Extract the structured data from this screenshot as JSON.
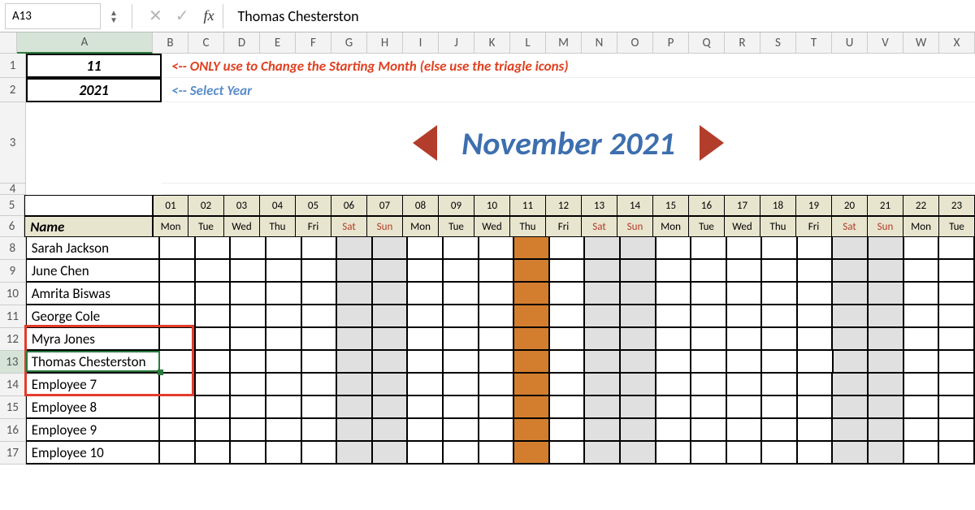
{
  "formula_bar": {
    "name_box": "A13",
    "fx_label": "fx",
    "formula_value": "Thomas Chesterston"
  },
  "columns": [
    "A",
    "B",
    "C",
    "D",
    "E",
    "F",
    "G",
    "H",
    "I",
    "J",
    "K",
    "L",
    "M",
    "N",
    "O",
    "P",
    "Q",
    "R",
    "S",
    "T",
    "U",
    "V",
    "W",
    "X"
  ],
  "row_labels": {
    "r1": "1",
    "r2": "2",
    "r3": "3",
    "r4": "4",
    "r5": "5",
    "r6": "6"
  },
  "cellA": {
    "r1": "11",
    "r2": "2021"
  },
  "hints": {
    "r1": "<-- ONLY use to Change the Starting Month (else use the triagle icons)",
    "r2": "<-- Select Year"
  },
  "month_title": "November 2021",
  "day_nums": [
    "01",
    "02",
    "03",
    "04",
    "05",
    "06",
    "07",
    "08",
    "09",
    "10",
    "11",
    "12",
    "13",
    "14",
    "15",
    "16",
    "17",
    "18",
    "19",
    "20",
    "21",
    "22",
    "23"
  ],
  "day_dows": [
    "Mon",
    "Tue",
    "Wed",
    "Thu",
    "Fri",
    "Sat",
    "Sun",
    "Mon",
    "Tue",
    "Wed",
    "Thu",
    "Fri",
    "Sat",
    "Sun",
    "Mon",
    "Tue",
    "Wed",
    "Thu",
    "Fri",
    "Sat",
    "Sun",
    "Mon",
    "Tue"
  ],
  "weekend_idx": [
    5,
    6,
    12,
    13,
    19,
    20
  ],
  "holiday_idx": [
    10
  ],
  "name_header": "Name",
  "employees": [
    {
      "row": "8",
      "name": "Sarah Jackson"
    },
    {
      "row": "9",
      "name": "June Chen"
    },
    {
      "row": "10",
      "name": "Amrita Biswas"
    },
    {
      "row": "11",
      "name": "George Cole"
    },
    {
      "row": "12",
      "name": "Myra Jones"
    },
    {
      "row": "13",
      "name": "Thomas Chesterston"
    },
    {
      "row": "14",
      "name": "Employee 7"
    },
    {
      "row": "15",
      "name": "Employee 8"
    },
    {
      "row": "16",
      "name": "Employee 9"
    },
    {
      "row": "17",
      "name": "Employee 10"
    }
  ],
  "active_cell_ref": "A13",
  "highlight_rows": [
    "12",
    "13",
    "14"
  ]
}
